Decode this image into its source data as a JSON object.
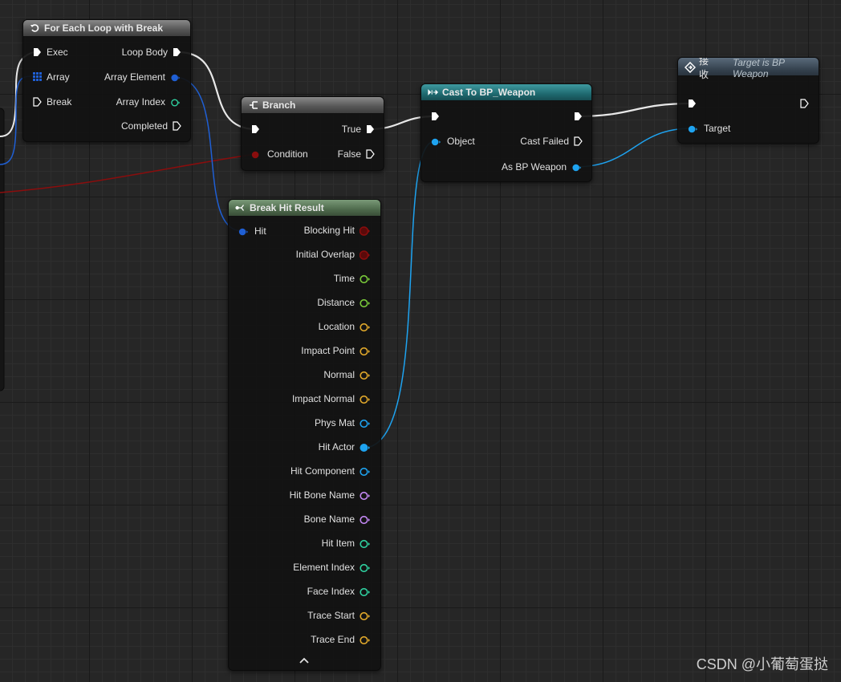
{
  "graph": {
    "nodes": {
      "for_each": {
        "title": "For Each Loop with Break",
        "inputs": [
          "Exec",
          "Array",
          "Break"
        ],
        "outputs": [
          "Loop Body",
          "Array Element",
          "Array Index",
          "Completed"
        ]
      },
      "branch": {
        "title": "Branch",
        "inputs": [
          "Condition"
        ],
        "outputs": [
          "True",
          "False"
        ]
      },
      "cast": {
        "title": "Cast To BP_Weapon",
        "inputs": [
          "Object"
        ],
        "outputs": [
          "Cast Failed",
          "As BP Weapon"
        ]
      },
      "receive": {
        "title": "接收",
        "subtitle": "Target is BP Weapon",
        "inputs": [
          "Target"
        ]
      },
      "break_hit": {
        "title": "Break Hit Result",
        "inputs": [
          "Hit"
        ],
        "outputs": [
          "Blocking Hit",
          "Initial Overlap",
          "Time",
          "Distance",
          "Location",
          "Impact Point",
          "Normal",
          "Impact Normal",
          "Phys Mat",
          "Hit Actor",
          "Hit Component",
          "Hit Bone Name",
          "Bone Name",
          "Hit Item",
          "Element Index",
          "Face Index",
          "Trace Start",
          "Trace End"
        ],
        "collapse_icon": "chevron-up-icon"
      }
    },
    "colors": {
      "exec": "#ffffff",
      "bool": "#8a0d0d",
      "float": "#7acb3a",
      "vector": "#e2a92b",
      "object": "#1ea3f0",
      "name": "#c488f4",
      "int": "#2fd1a0",
      "struct": "#1f5fd4"
    }
  },
  "watermark": "CSDN @小葡萄蛋挞"
}
